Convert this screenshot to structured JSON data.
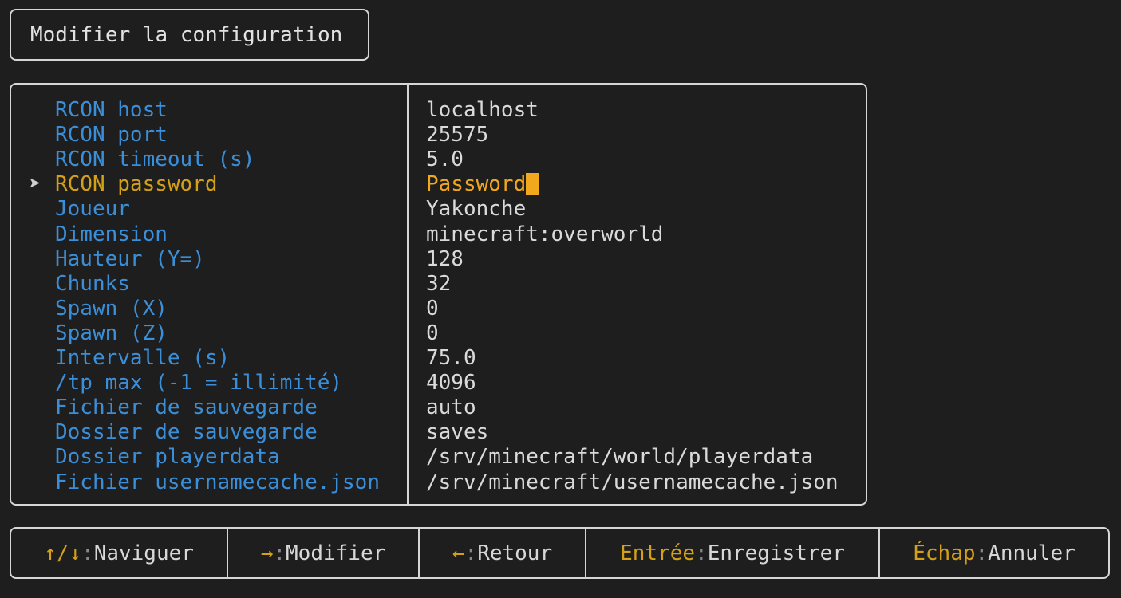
{
  "title": "Modifier la configuration",
  "selected_marker": "➤",
  "rows": [
    {
      "label": "RCON host",
      "value": "localhost"
    },
    {
      "label": "RCON port",
      "value": "25575"
    },
    {
      "label": "RCON timeout (s)",
      "value": "5.0"
    },
    {
      "label": "RCON password",
      "value": "Password",
      "selected": true
    },
    {
      "label": "Joueur",
      "value": "Yakonche"
    },
    {
      "label": "Dimension",
      "value": "minecraft:overworld"
    },
    {
      "label": "Hauteur (Y=)",
      "value": "128"
    },
    {
      "label": "Chunks",
      "value": "32"
    },
    {
      "label": "Spawn (X)",
      "value": "0"
    },
    {
      "label": "Spawn (Z)",
      "value": "0"
    },
    {
      "label": "Intervalle (s)",
      "value": "75.0"
    },
    {
      "label": "/tp max (-1 = illimité)",
      "value": "4096"
    },
    {
      "label": "Fichier de sauvegarde",
      "value": "auto"
    },
    {
      "label": "Dossier de sauvegarde",
      "value": "saves"
    },
    {
      "label": "Dossier playerdata",
      "value": "/srv/minecraft/world/playerdata"
    },
    {
      "label": "Fichier usernamecache.json",
      "value": "/srv/minecraft/usernamecache.json"
    }
  ],
  "footer": {
    "separator": ":",
    "hints": [
      {
        "key": "↑/↓",
        "action": "Naviguer"
      },
      {
        "key": "→",
        "action": "Modifier"
      },
      {
        "key": "←",
        "action": "Retour"
      },
      {
        "key": "Entrée",
        "action": "Enregistrer"
      },
      {
        "key": "Échap",
        "action": "Annuler"
      }
    ]
  },
  "colors": {
    "background": "#1e1e1e",
    "border": "#d6d6d6",
    "label": "#3b8fd9",
    "selected_label": "#d4a017",
    "selected_value": "#f2a81d",
    "value": "#dadada"
  }
}
